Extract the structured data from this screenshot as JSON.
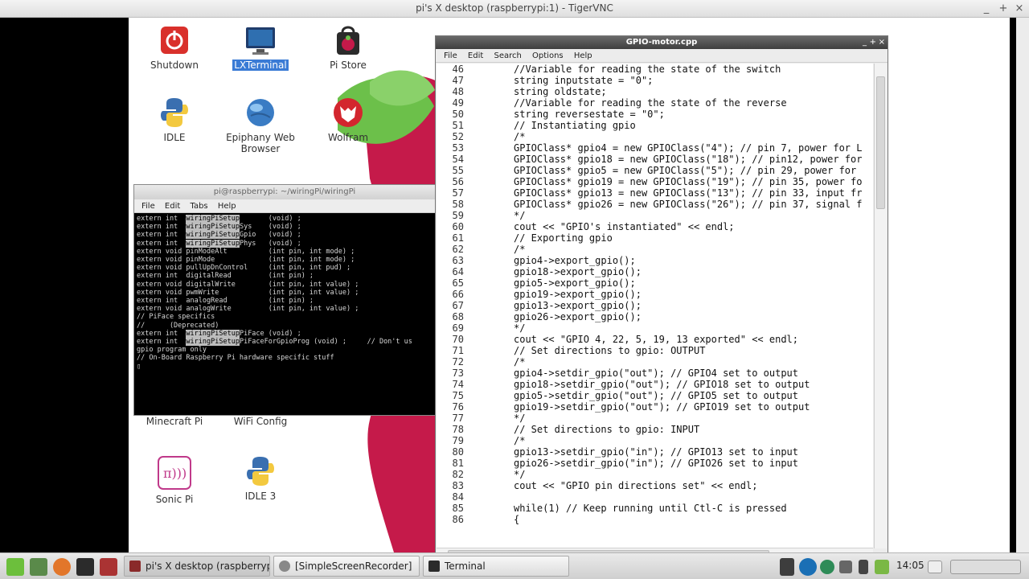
{
  "vnc": {
    "title": "pi's X desktop (raspberrypi:1) - TigerVNC",
    "minimize": "_",
    "maximize": "+",
    "close": "×"
  },
  "desktop_icons": [
    {
      "label": "Shutdown",
      "icon": "power-icon",
      "selected": false
    },
    {
      "label": "LXTerminal",
      "icon": "monitor-icon",
      "selected": true
    },
    {
      "label": "Pi Store",
      "icon": "shopping-bag-icon",
      "selected": false
    },
    {
      "label": "IDLE",
      "icon": "python-icon",
      "selected": false
    },
    {
      "label": "Epiphany Web Browser",
      "icon": "globe-icon",
      "selected": false
    },
    {
      "label": "Wolfram",
      "icon": "wolf-icon",
      "selected": false
    },
    {
      "label": "Minecraft Pi",
      "icon": "minecraft-icon",
      "selected": false
    },
    {
      "label": "WiFi Config",
      "icon": "wifi-icon",
      "selected": false
    },
    {
      "label": "Sonic Pi",
      "icon": "sonic-pi-icon",
      "selected": false
    },
    {
      "label": "IDLE 3",
      "icon": "python-icon",
      "selected": false
    }
  ],
  "terminal": {
    "title": "pi@raspberrypi: ~/wiringPi/wiringPi",
    "menu": [
      "File",
      "Edit",
      "Tabs",
      "Help"
    ],
    "lines": [
      {
        "pre": "extern int  ",
        "hl": "wiringPiSetup",
        "post": "       (void) ;"
      },
      {
        "pre": "extern int  ",
        "hl": "wiringPiSetup",
        "post": "Sys    (void) ;"
      },
      {
        "pre": "extern int  ",
        "hl": "wiringPiSetup",
        "post": "Gpio   (void) ;"
      },
      {
        "pre": "extern int  ",
        "hl": "wiringPiSetup",
        "post": "Phys   (void) ;"
      },
      {
        "pre": "",
        "hl": "",
        "post": ""
      },
      {
        "pre": "extern void pinModeAlt          (int pin, int mode) ;",
        "hl": "",
        "post": ""
      },
      {
        "pre": "extern void pinMode             (int pin, int mode) ;",
        "hl": "",
        "post": ""
      },
      {
        "pre": "extern void pullUpDnControl     (int pin, int pud) ;",
        "hl": "",
        "post": ""
      },
      {
        "pre": "extern int  digitalRead         (int pin) ;",
        "hl": "",
        "post": ""
      },
      {
        "pre": "extern void digitalWrite        (int pin, int value) ;",
        "hl": "",
        "post": ""
      },
      {
        "pre": "extern void pwmWrite            (int pin, int value) ;",
        "hl": "",
        "post": ""
      },
      {
        "pre": "extern int  analogRead          (int pin) ;",
        "hl": "",
        "post": ""
      },
      {
        "pre": "extern void analogWrite         (int pin, int value) ;",
        "hl": "",
        "post": ""
      },
      {
        "pre": "",
        "hl": "",
        "post": ""
      },
      {
        "pre": "// PiFace specifics",
        "hl": "",
        "post": ""
      },
      {
        "pre": "//      (Deprecated)",
        "hl": "",
        "post": ""
      },
      {
        "pre": "",
        "hl": "",
        "post": ""
      },
      {
        "pre": "extern int  ",
        "hl": "wiringPiSetup",
        "post": "PiFace (void) ;"
      },
      {
        "pre": "extern int  ",
        "hl": "wiringPiSetup",
        "post": "PiFaceForGpioProg (void) ;     // Don't us"
      },
      {
        "pre": "gpio program only",
        "hl": "",
        "post": ""
      },
      {
        "pre": "",
        "hl": "",
        "post": ""
      },
      {
        "pre": "// On-Board Raspberry Pi hardware specific stuff",
        "hl": "",
        "post": ""
      },
      {
        "pre": "",
        "hl": "",
        "post": ""
      },
      {
        "pre": "▯",
        "hl": "",
        "post": ""
      }
    ]
  },
  "editor": {
    "title": "GPIO-motor.cpp",
    "menu": [
      "File",
      "Edit",
      "Search",
      "Options",
      "Help"
    ],
    "lines": [
      {
        "n": "46",
        "t": "//Variable for reading the state of the switch"
      },
      {
        "n": "47",
        "t": "string inputstate = \"0\";"
      },
      {
        "n": "48",
        "t": "string oldstate;"
      },
      {
        "n": "49",
        "t": "//Variable for reading the state of the reverse"
      },
      {
        "n": "50",
        "t": "string reversestate = \"0\";"
      },
      {
        "n": "51",
        "t": "// Instantiating gpio"
      },
      {
        "n": "52",
        "t": "/*"
      },
      {
        "n": "53",
        "t": "GPIOClass* gpio4 = new GPIOClass(\"4\"); // pin 7, power for L"
      },
      {
        "n": "54",
        "t": "GPIOClass* gpio18 = new GPIOClass(\"18\"); // pin12, power for"
      },
      {
        "n": "55",
        "t": "GPIOClass* gpio5 = new GPIOClass(\"5\"); // pin 29, power for"
      },
      {
        "n": "56",
        "t": "GPIOClass* gpio19 = new GPIOClass(\"19\"); // pin 35, power fo"
      },
      {
        "n": "57",
        "t": "GPIOClass* gpio13 = new GPIOClass(\"13\"); // pin 33, input fr"
      },
      {
        "n": "58",
        "t": "GPIOClass* gpio26 = new GPIOClass(\"26\"); // pin 37, signal f"
      },
      {
        "n": "59",
        "t": "*/"
      },
      {
        "n": "60",
        "t": "cout << \"GPIO's instantiated\" << endl;"
      },
      {
        "n": "61",
        "t": "// Exporting gpio"
      },
      {
        "n": "62",
        "t": "/*"
      },
      {
        "n": "63",
        "t": "gpio4->export_gpio();"
      },
      {
        "n": "64",
        "t": "gpio18->export_gpio();"
      },
      {
        "n": "65",
        "t": "gpio5->export_gpio();"
      },
      {
        "n": "66",
        "t": "gpio19->export_gpio();"
      },
      {
        "n": "67",
        "t": "gpio13->export_gpio();"
      },
      {
        "n": "68",
        "t": "gpio26->export_gpio();"
      },
      {
        "n": "69",
        "t": "*/"
      },
      {
        "n": "70",
        "t": "cout << \"GPIO 4, 22, 5, 19, 13 exported\" << endl;"
      },
      {
        "n": "71",
        "t": "// Set directions to gpio: OUTPUT"
      },
      {
        "n": "72",
        "t": "/*"
      },
      {
        "n": "73",
        "t": "gpio4->setdir_gpio(\"out\"); // GPIO4 set to output"
      },
      {
        "n": "74",
        "t": "gpio18->setdir_gpio(\"out\"); // GPIO18 set to output"
      },
      {
        "n": "75",
        "t": "gpio5->setdir_gpio(\"out\"); // GPIO5 set to output"
      },
      {
        "n": "76",
        "t": "gpio19->setdir_gpio(\"out\"); // GPIO19 set to output"
      },
      {
        "n": "77",
        "t": "*/"
      },
      {
        "n": "78",
        "t": "// Set directions to gpio: INPUT"
      },
      {
        "n": "79",
        "t": "/*"
      },
      {
        "n": "80",
        "t": "gpio13->setdir_gpio(\"in\"); // GPIO13 set to input"
      },
      {
        "n": "81",
        "t": "gpio26->setdir_gpio(\"in\"); // GPIO26 set to input"
      },
      {
        "n": "82",
        "t": "*/"
      },
      {
        "n": "83",
        "t": "cout << \"GPIO pin directions set\" << endl;"
      },
      {
        "n": "84",
        "t": ""
      },
      {
        "n": "85",
        "t": "while(1) // Keep running until Ctl-C is pressed"
      },
      {
        "n": "86",
        "t": "{"
      }
    ]
  },
  "taskbar": {
    "buttons": [
      {
        "label": "pi's X desktop (raspberrypi:1...",
        "icon": "vnc-icon",
        "active": true
      },
      {
        "label": "[SimpleScreenRecorder]",
        "icon": "record-icon",
        "active": false
      },
      {
        "label": "Terminal",
        "icon": "terminal-icon",
        "active": false
      }
    ],
    "clock": "14:05",
    "launchers": [
      "mint-menu-icon",
      "desktop-icon",
      "firefox-icon",
      "terminal-icon",
      "vnc-icon"
    ],
    "tray": [
      "pen-icon",
      "hp-icon",
      "globe-icon",
      "volume-icon",
      "bluetooth-icon",
      "shield-icon"
    ]
  },
  "colors": {
    "raspberry_red": "#c51a4a",
    "leaf_green": "#6cc04a",
    "selection_blue": "#3a7bd5",
    "terminal_bg": "#000000"
  }
}
